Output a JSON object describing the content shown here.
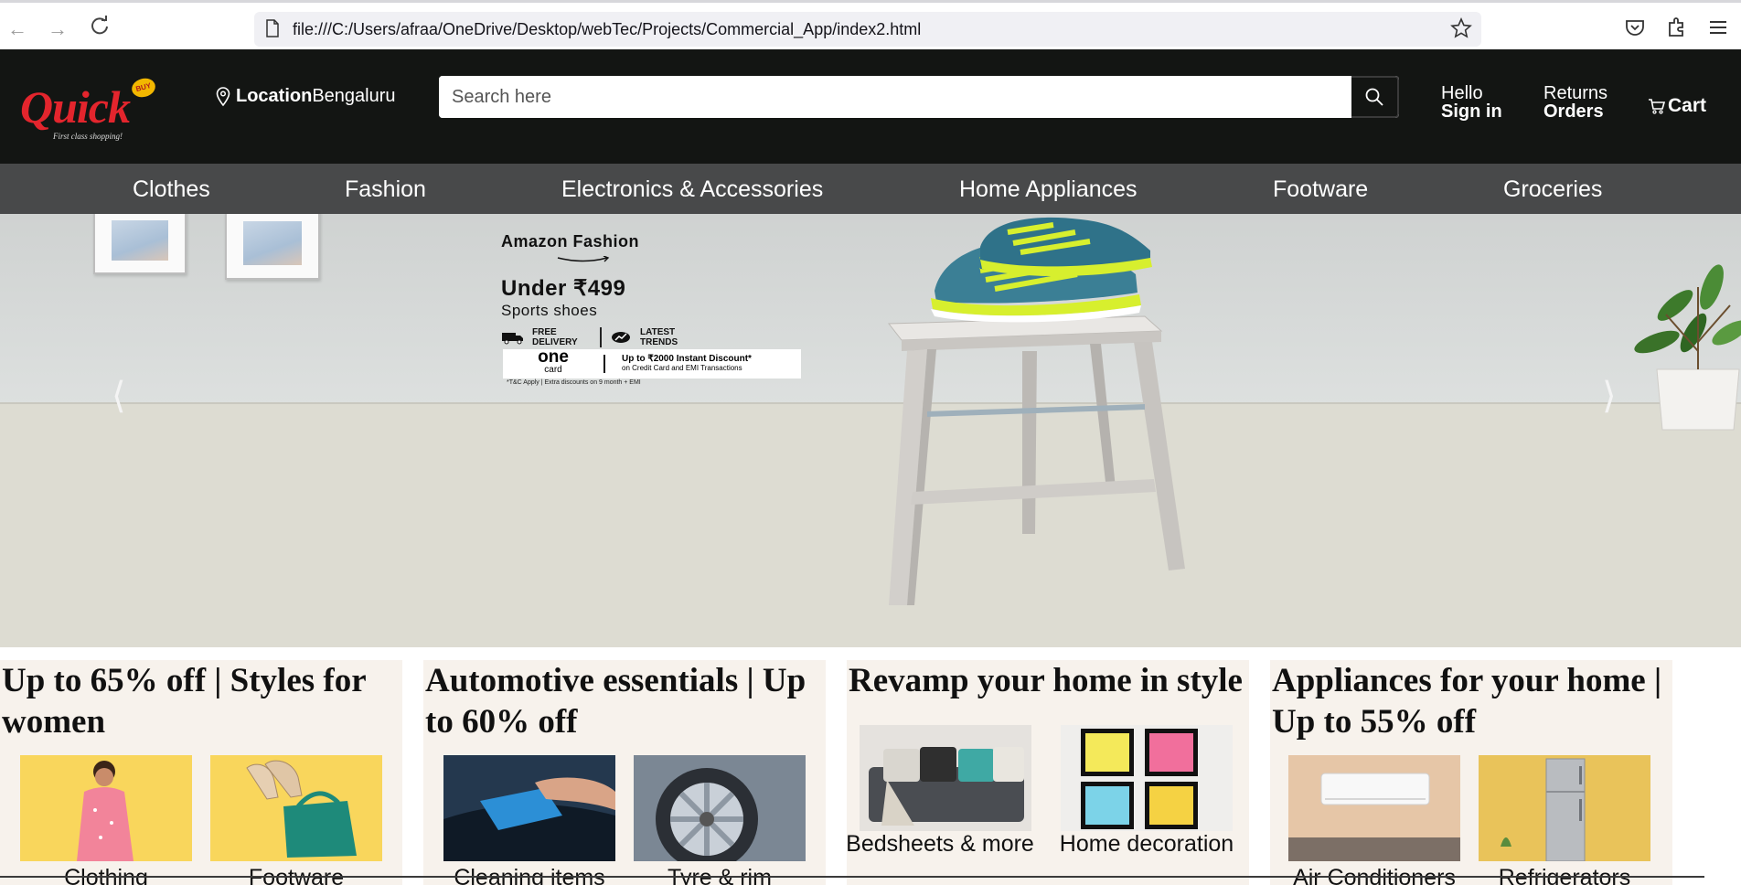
{
  "browser": {
    "url": "file:///C:/Users/afraa/OneDrive/Desktop/webTec/Projects/Commercial_App/index2.html"
  },
  "header": {
    "logo_text": "Quick",
    "logo_badge": "BUY",
    "logo_tagline": "First class shopping!",
    "location_label": "Location",
    "location_value": "Bengaluru",
    "search_placeholder": "Search here",
    "signin_line1": "Hello",
    "signin_line2": "Sign in",
    "returns_line1": "Returns",
    "returns_line2": "Orders",
    "cart_label": "Cart"
  },
  "categories": [
    "Clothes",
    "Fashion",
    "Electronics & Accessories",
    "Home Appliances",
    "Footware",
    "Groceries"
  ],
  "hero": {
    "brand": "Amazon Fashion",
    "price": "Under ₹499",
    "subtitle": "Sports shoes",
    "perk1": "FREE DELIVERY",
    "perk2": "LATEST TRENDS",
    "card_logo": "one",
    "card_logo_sub": "card",
    "card_offer": "Up to ₹2000 Instant Discount*",
    "card_offer_sub": "on Credit Card and EMI Transactions",
    "fine_print": "*T&C Apply | Extra discounts on 9 month + EMI",
    "colors": {
      "wall": "#d4d7d6",
      "floor": "#dddcd2"
    }
  },
  "cards": [
    {
      "title": "Up to 65% off | Styles for women",
      "items": [
        "Clothing",
        "Footware"
      ]
    },
    {
      "title": "Automotive essentials | Up to 60% off",
      "items": [
        "Cleaning items",
        "Tyre & rim"
      ]
    },
    {
      "title": "Revamp your home in style",
      "items": [
        "Bedsheets & more",
        "Home decoration"
      ]
    },
    {
      "title": "Appliances for your home | Up to 55% off",
      "items": [
        "Air Conditioners",
        "Refrigerators"
      ]
    }
  ],
  "colors": {
    "header_bg": "#131513",
    "nav_bg": "#48494a",
    "brand_red": "#e3252d",
    "card_bg": "#f7f2ec"
  }
}
